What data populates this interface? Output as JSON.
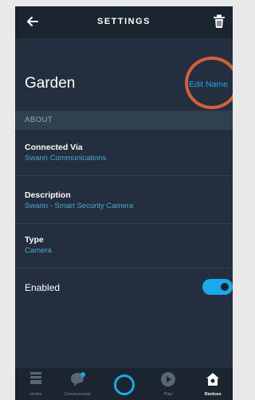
{
  "header": {
    "title": "SETTINGS"
  },
  "device": {
    "name": "Garden",
    "edit_label": "Edit Name"
  },
  "about": {
    "header": "ABOUT",
    "fields": [
      {
        "label": "Connected Via",
        "value": "Swann Communications"
      },
      {
        "label": "Description",
        "value": "Swann - Smart Security Camera"
      },
      {
        "label": "Type",
        "value": "Camera"
      }
    ]
  },
  "enabled": {
    "label": "Enabled",
    "state": true
  },
  "nav": {
    "items": [
      {
        "label": "Home",
        "icon": "home-icon"
      },
      {
        "label": "Communicate",
        "icon": "chat-bubble-icon"
      },
      {
        "label": "",
        "icon": "alexa-icon"
      },
      {
        "label": "Play",
        "icon": "play-icon"
      },
      {
        "label": "Devices",
        "icon": "devices-icon"
      }
    ],
    "active": "Devices"
  },
  "colors": {
    "background": "#232f3e",
    "accent": "#1ba9ea",
    "highlight_ring": "#d65f3b"
  }
}
